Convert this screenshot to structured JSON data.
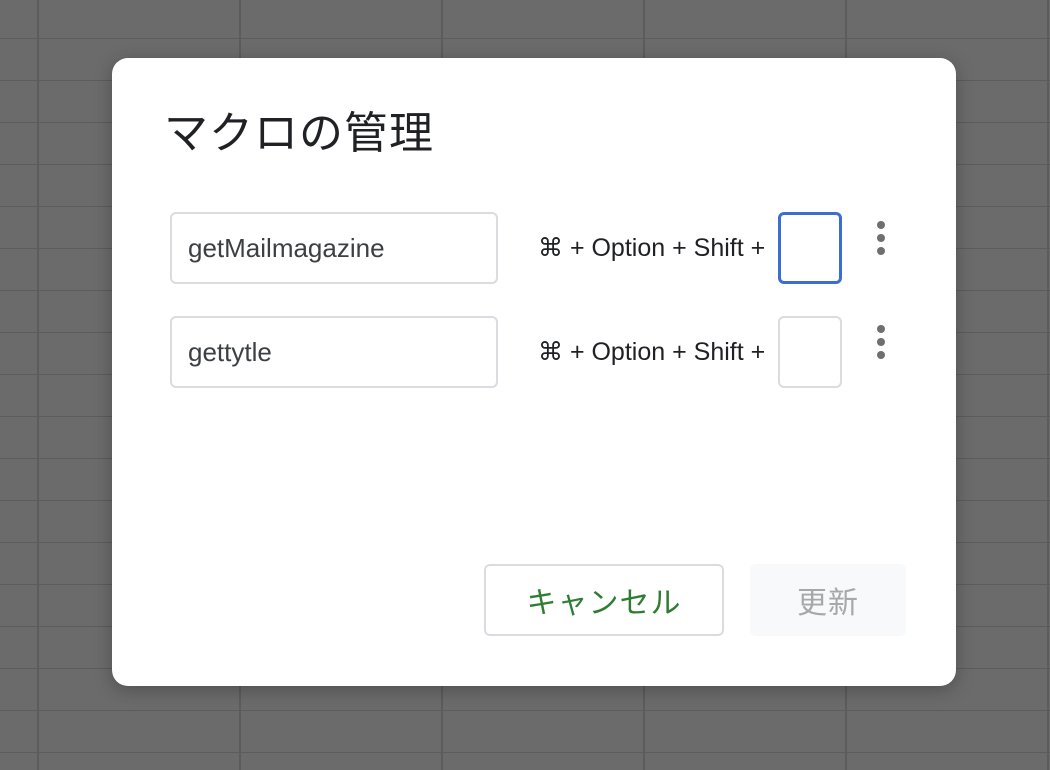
{
  "dialog": {
    "title": "マクロの管理",
    "macros": [
      {
        "name": "getMailmagazine",
        "shortcut_label": "⌘ + Option + Shift +",
        "key": ""
      },
      {
        "name": "gettytle",
        "shortcut_label": "⌘ + Option + Shift +",
        "key": ""
      }
    ],
    "more_icon": "more-vert-icon",
    "cancel_label": "キャンセル",
    "update_label": "更新"
  },
  "colors": {
    "background": "#6b6b6b",
    "dialog": "#ffffff",
    "focus_border": "#3b6fcf",
    "cancel_text": "#2e7d32",
    "update_text_disabled": "#a8a8a8"
  }
}
